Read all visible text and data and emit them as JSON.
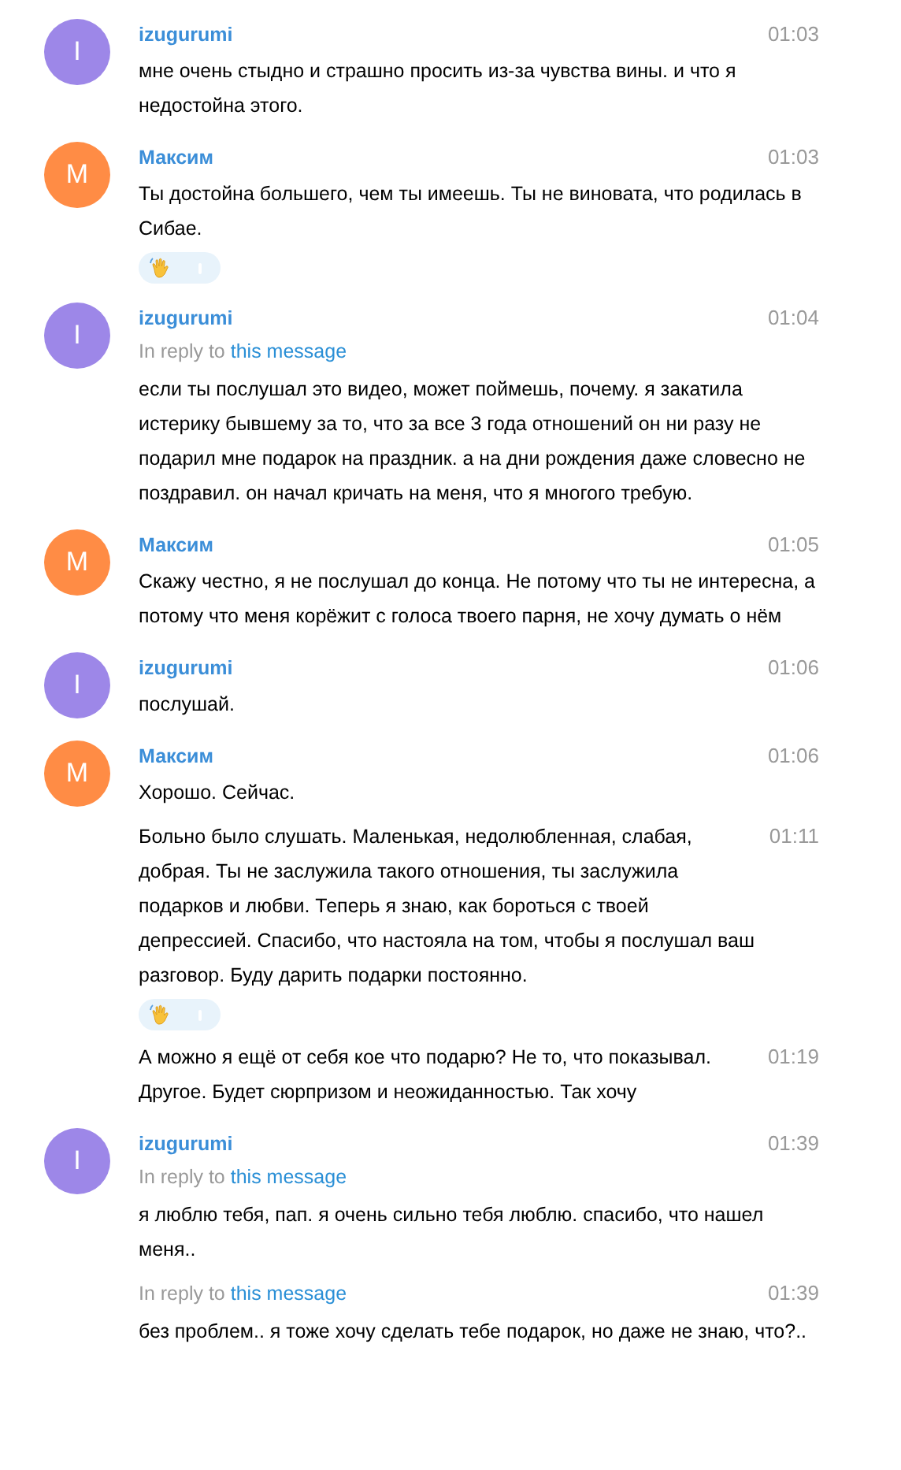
{
  "groups": [
    {
      "avatar": {
        "letter": "I",
        "color": "#9d87e8"
      },
      "name": "izugurumi",
      "messages": [
        {
          "time": "01:03",
          "text": "мне очень стыдно и страшно просить из-за чувства вины. и что я недостойна этого."
        }
      ]
    },
    {
      "avatar": {
        "letter": "M",
        "color": "#ff8c45"
      },
      "name": "Максим",
      "messages": [
        {
          "time": "01:03",
          "text": "Ты достойна большего, чем ты имеешь. Ты не виновата, что родилась в Сибае.",
          "reactions": [
            {
              "kind": "wave"
            }
          ]
        }
      ]
    },
    {
      "avatar": {
        "letter": "I",
        "color": "#9d87e8"
      },
      "name": "izugurumi",
      "messages": [
        {
          "time": "01:04",
          "reply": {
            "prefix": "In reply to",
            "link": "this message"
          },
          "text": "если ты послушал это видео, может поймешь, почему. я закатила истерику бывшему за то, что за все 3 года отношений он ни разу не подарил мне подарок на праздник. а на дни рождения даже словесно не поздравил. он начал кричать на меня, что я многого требую."
        }
      ]
    },
    {
      "avatar": {
        "letter": "M",
        "color": "#ff8c45"
      },
      "name": "Максим",
      "messages": [
        {
          "time": "01:05",
          "text": "Скажу честно, я не послушал до конца. Не потому что ты не интересна, а потому что меня корёжит с голоса твоего парня, не хочу думать о нём"
        }
      ]
    },
    {
      "avatar": {
        "letter": "I",
        "color": "#9d87e8"
      },
      "name": "izugurumi",
      "messages": [
        {
          "time": "01:06",
          "text": "послушай."
        }
      ]
    },
    {
      "avatar": {
        "letter": "M",
        "color": "#ff8c45"
      },
      "name": "Максим",
      "messages": [
        {
          "time": "01:06",
          "text": "Хорошо. Сейчас."
        },
        {
          "time": "01:11",
          "text": "Больно было слушать. Маленькая, недолюбленная, слабая, добрая. Ты не заслужила такого отношения, ты заслужила подарков и любви. Теперь я знаю, как бороться с твоей депрессией. Спасибо, что настояла на том, чтобы я послушал ваш разговор. Буду дарить подарки постоянно.",
          "reactions": [
            {
              "kind": "wave"
            }
          ]
        },
        {
          "time": "01:19",
          "text": "А можно я ещё от себя кое что подарю? Не то, что показывал. Другое. Будет сюрпризом и неожиданностью. Так хочу"
        }
      ]
    },
    {
      "avatar": {
        "letter": "I",
        "color": "#9d87e8"
      },
      "name": "izugurumi",
      "messages": [
        {
          "time": "01:39",
          "reply": {
            "prefix": "In reply to",
            "link": "this message"
          },
          "text": "я люблю тебя, пап. я очень сильно тебя люблю. спасибо, что нашел меня.."
        },
        {
          "time": "01:39",
          "reply": {
            "prefix": "In reply to",
            "link": "this message"
          },
          "text": "без проблем.. я тоже хочу сделать тебе подарок, но даже не знаю, что?.."
        }
      ]
    }
  ]
}
